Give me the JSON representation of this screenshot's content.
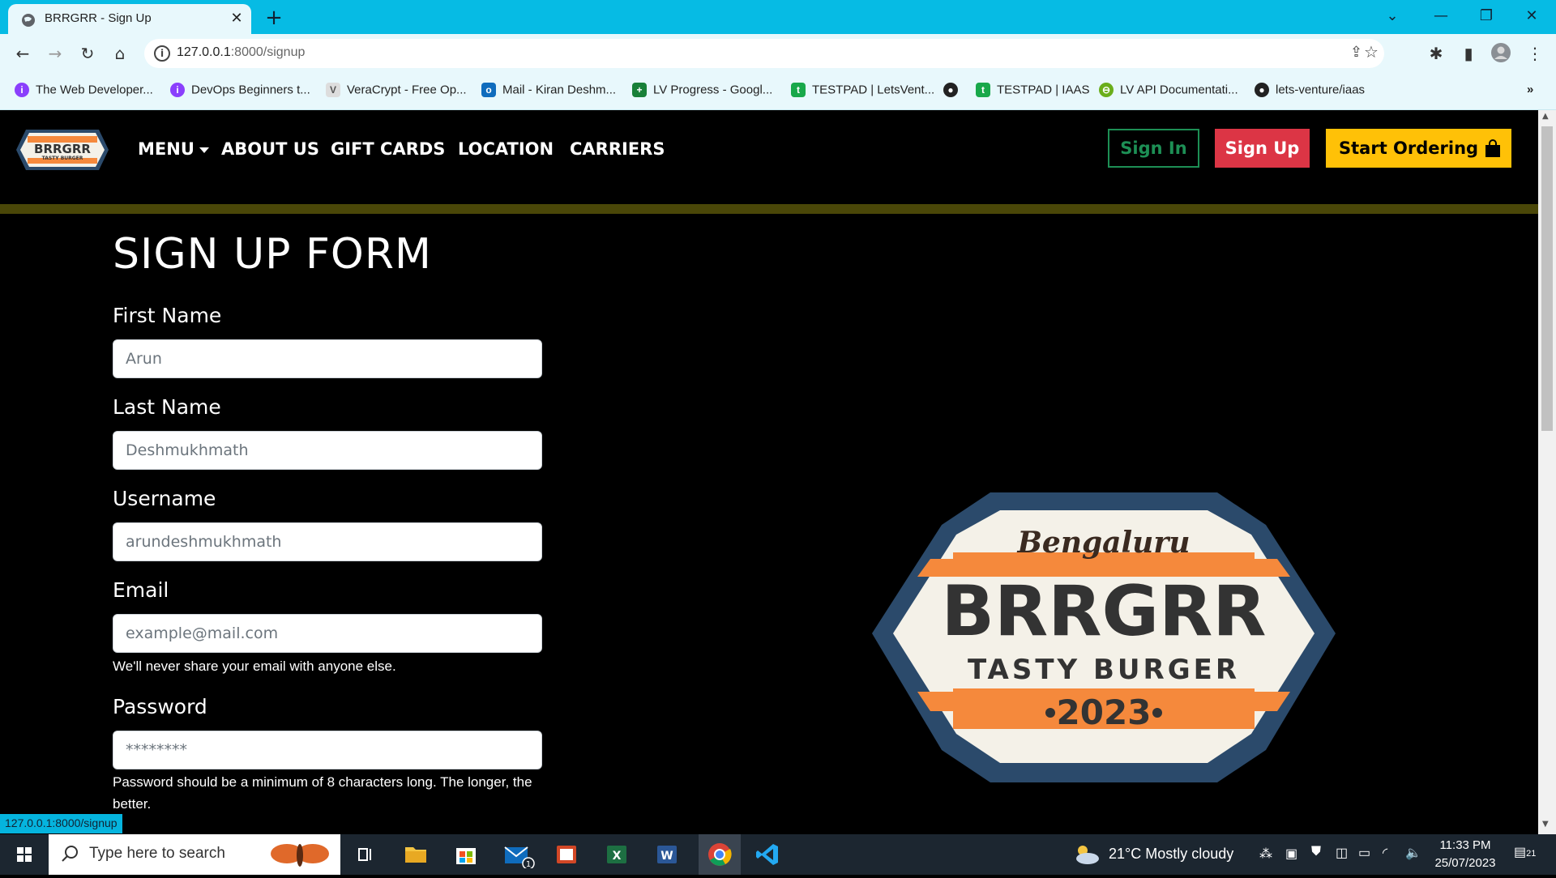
{
  "browser": {
    "tab_title": "BRRGRR - Sign Up",
    "url_host": "127.0.0.1",
    "url_rest": ":8000/signup",
    "bookmarks": [
      {
        "label": "The Web Developer...",
        "color": "#8a3ffc"
      },
      {
        "label": "DevOps Beginners t...",
        "color": "#8a3ffc"
      },
      {
        "label": "VeraCrypt - Free Op...",
        "color": "#777777"
      },
      {
        "label": "Mail - Kiran Deshm...",
        "color": "#0f6cbd"
      },
      {
        "label": "LV Progress - Googl...",
        "color": "#188038"
      },
      {
        "label": "TESTPAD | LetsVent...",
        "color": "#18a84a"
      },
      {
        "label": "",
        "color": "#222222"
      },
      {
        "label": "TESTPAD | IAAS",
        "color": "#18a84a"
      },
      {
        "label": "LV API Documentati...",
        "color": "#6aae1b"
      },
      {
        "label": "lets-venture/iaas",
        "color": "#222222"
      }
    ]
  },
  "nav": {
    "brand": {
      "top": "Bengaluru",
      "name": "BRRGRR",
      "sub": "TASTY BURGER",
      "year": "2023"
    },
    "links": {
      "menu": "MENU",
      "about": "ABOUT US",
      "gift": "GIFT CARDS",
      "location": "LOCATION",
      "carriers": "CARRIERS"
    },
    "sign_in": "Sign In",
    "sign_up": "Sign Up",
    "start_ordering": "Start Ordering"
  },
  "form": {
    "title": "SIGN UP FORM",
    "first_name_label": "First Name",
    "first_name_placeholder": "Arun",
    "last_name_label": "Last Name",
    "last_name_placeholder": "Deshmukhmath",
    "username_label": "Username",
    "username_placeholder": "arundeshmukhmath",
    "email_label": "Email",
    "email_placeholder": "example@mail.com",
    "email_help": "We'll never share your email with anyone else.",
    "password_label": "Password",
    "password_placeholder": "********",
    "password_help": "Password should be a minimum of 8 characters long. The longer, the better."
  },
  "status_url": "127.0.0.1:8000/signup",
  "taskbar": {
    "search_placeholder": "Type here to search",
    "weather": "21°C  Mostly cloudy",
    "time": "11:33 PM",
    "date": "25/07/2023",
    "mail_badge": "1",
    "notif_badge": "21"
  },
  "colors": {
    "tabstrip": "#06bbe4",
    "toolbar": "#e8f8fc",
    "sign_in": "#1d8f55",
    "sign_up": "#dc3545",
    "order": "#ffc107",
    "logo_navy": "#2b4a6b",
    "logo_orange": "#f5893c",
    "logo_cream": "#f4f1e8"
  }
}
